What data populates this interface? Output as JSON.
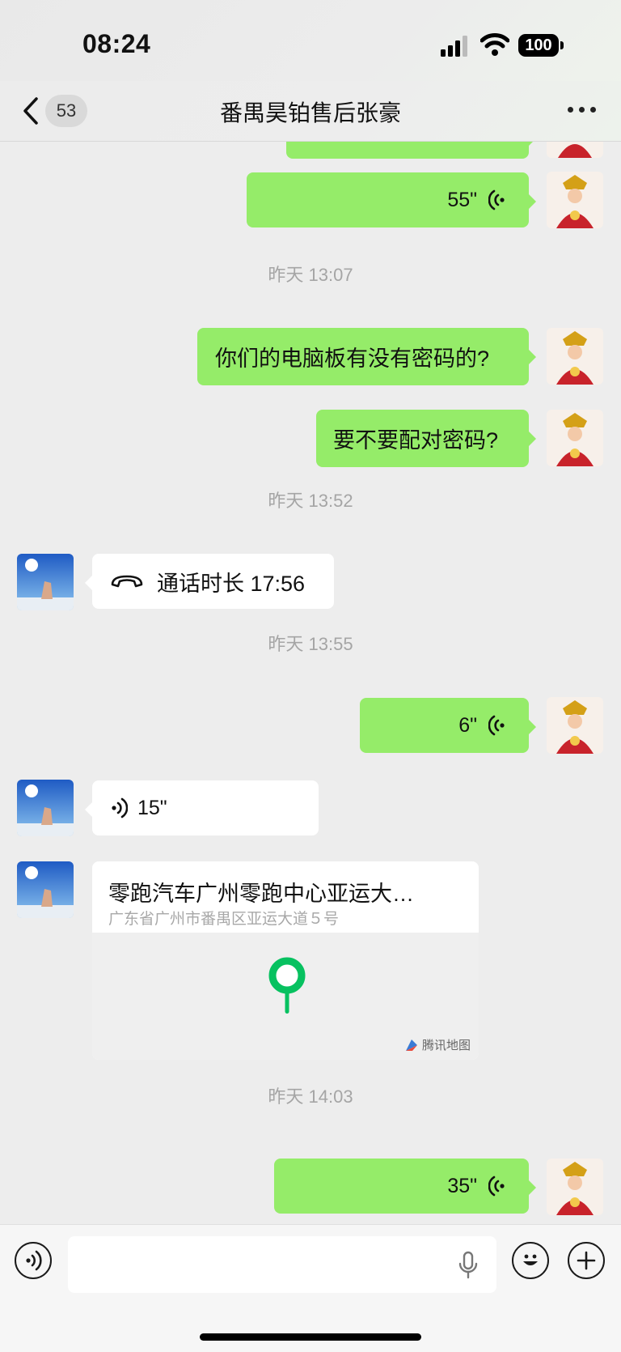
{
  "status_bar": {
    "time": "08:24",
    "battery": "100"
  },
  "nav": {
    "back_count": "53",
    "title": "番禺昊铂售后张豪"
  },
  "messages": {
    "voice1": "55\"",
    "ts1": "昨天 13:07",
    "text1": "你们的电脑板有没有密码的?",
    "text2": "要不要配对密码?",
    "ts2": "昨天 13:52",
    "call": "通话时长 17:56",
    "ts3": "昨天 13:55",
    "voice2": "6\"",
    "voice3": "15\"",
    "location_title": "零跑汽车广州零跑中心亚运大…",
    "location_address": "广东省广州市番禺区亚运大道５号",
    "map_credit": "腾讯地图",
    "ts4": "昨天 14:03",
    "voice4": "35\""
  },
  "colors": {
    "outgoing": "#95ec69",
    "incoming": "#ffffff",
    "background": "#ededed",
    "pin": "#07c160"
  }
}
